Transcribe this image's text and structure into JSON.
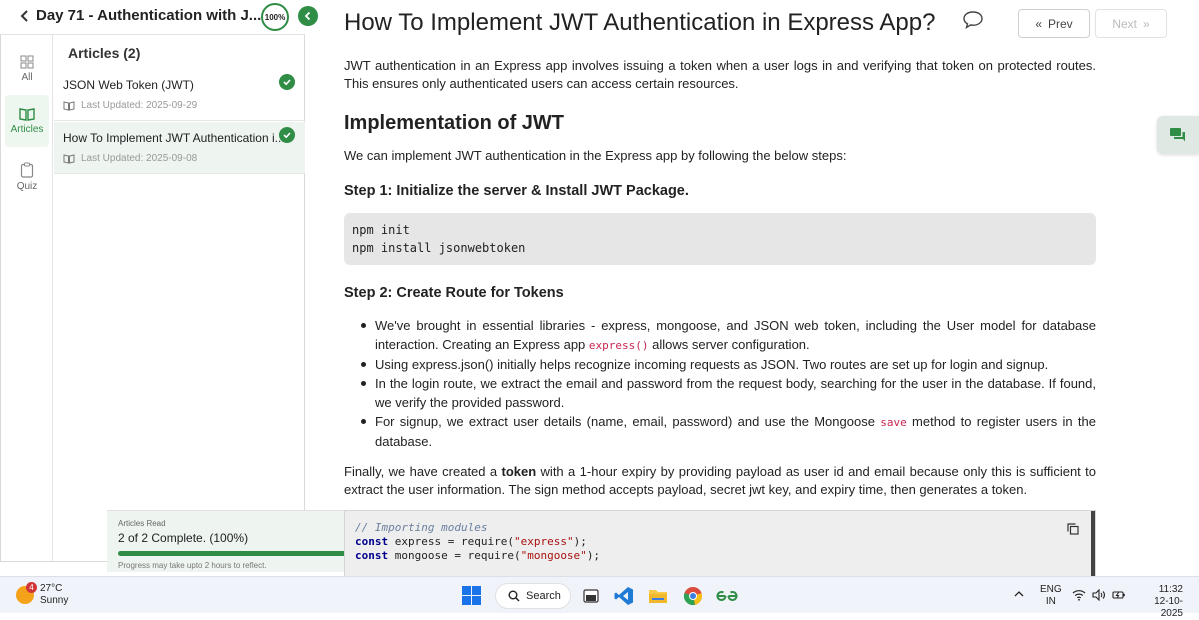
{
  "header": {
    "course_title": "Day 71 - Authentication with J...",
    "progress_label": "100%"
  },
  "rail": {
    "items": [
      {
        "label": "All"
      },
      {
        "label": "Articles"
      },
      {
        "label": "Quiz"
      }
    ]
  },
  "articles": {
    "title": "Articles (2)",
    "items": [
      {
        "name": "JSON Web Token (JWT)",
        "updated": "Last Updated: 2025-09-29"
      },
      {
        "name": "How To Implement JWT Authentication i...",
        "updated": "Last Updated: 2025-09-08"
      }
    ]
  },
  "read_status": {
    "label": "Articles Read",
    "count": "2 of 2 Complete. (100%)",
    "progress": 1.0,
    "note": "Progress may take upto 2 hours to reflect."
  },
  "main": {
    "title": "How To Implement JWT Authentication in Express App?",
    "prev_label": "Prev",
    "next_label": "Next",
    "intro": "JWT authentication in an Express app involves issuing a token when a user logs in and verifying that token on protected routes. This ensures only authenticated users can access certain resources.",
    "h2": "Implementation of JWT",
    "steps_intro": "We can implement JWT authentication in the Express app by following the below steps:",
    "step1_title": "Step 1: Initialize the server & Install JWT Package.",
    "step1_code": [
      "npm init",
      "npm install jsonwebtoken"
    ],
    "step2_title": "Step 2: Create Route for Tokens",
    "bullets": {
      "b1_before": "We've brought in essential libraries - express, mongoose, and JSON web token, including the User model for database interaction. Creating an Express app ",
      "b1_code": "express()",
      "b1_after": " allows server configuration.",
      "b2": "Using express.json() initially helps recognize incoming requests as JSON. Two routes are set up for login and signup.",
      "b3": "In the login route, we extract the email and password from the request body, searching for the user in the database. If found, we verify the provided password.",
      "b4_before": "For signup, we extract user details (name, email, password) and use the Mongoose ",
      "b4_code": "save",
      "b4_after": " method to register users in the database."
    },
    "finally_before": "Finally, we have created a ",
    "finally_bold": "token",
    "finally_after": " with a 1-hour expiry by providing payload as user id and email because only this is sufficient to extract the user information.  The sign method accepts payload, secret jwt key, and expiry time, then generates a token.",
    "code2": {
      "comment": "// Importing modules",
      "kw": "const",
      "l1_mid": " express = require(",
      "l1_str": "\"express\"",
      "l1_end": ");",
      "l2_mid": " mongoose = require(",
      "l2_str": "\"mongoose\"",
      "l2_end": ");"
    }
  },
  "taskbar": {
    "badge": "4",
    "temp": "27°C",
    "weather": "Sunny",
    "search": "Search",
    "lang1": "ENG",
    "lang2": "IN",
    "time": "11:32",
    "date": "12-10-2025"
  },
  "colors": {
    "accent": "#2f8d46"
  }
}
